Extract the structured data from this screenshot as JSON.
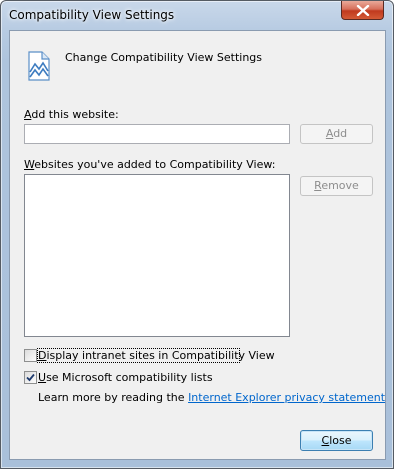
{
  "window": {
    "title": "Compatibility View Settings"
  },
  "header": {
    "heading": "Change Compatibility View Settings",
    "icon": "compatibility-page-icon"
  },
  "add_website": {
    "label_mnemonic": "A",
    "label_rest": "dd this website:",
    "input_value": "",
    "add_button_mnemonic": "A",
    "add_button_rest": "dd",
    "add_button_enabled": false
  },
  "websites_list": {
    "label_mnemonic": "W",
    "label_rest": "ebsites you've added to Compatibility View:",
    "items": [],
    "remove_button_mnemonic": "R",
    "remove_button_rest": "emove",
    "remove_button_enabled": false
  },
  "options": {
    "intranet": {
      "label_mnemonic": "D",
      "label_rest": "isplay intranet sites in Compatibility View",
      "checked": false
    },
    "ms_lists": {
      "label_mnemonic": "U",
      "label_rest": "se Microsoft compatibility lists",
      "checked": true
    }
  },
  "learn_more": {
    "prefix": "Learn more by reading the",
    "link_text": "Internet Explorer privacy statement"
  },
  "footer": {
    "close_mnemonic": "C",
    "close_rest": "lose"
  },
  "colors": {
    "link": "#0066cc",
    "close_button_red": "#c03a1e",
    "default_button_border": "#3c7fb1"
  }
}
